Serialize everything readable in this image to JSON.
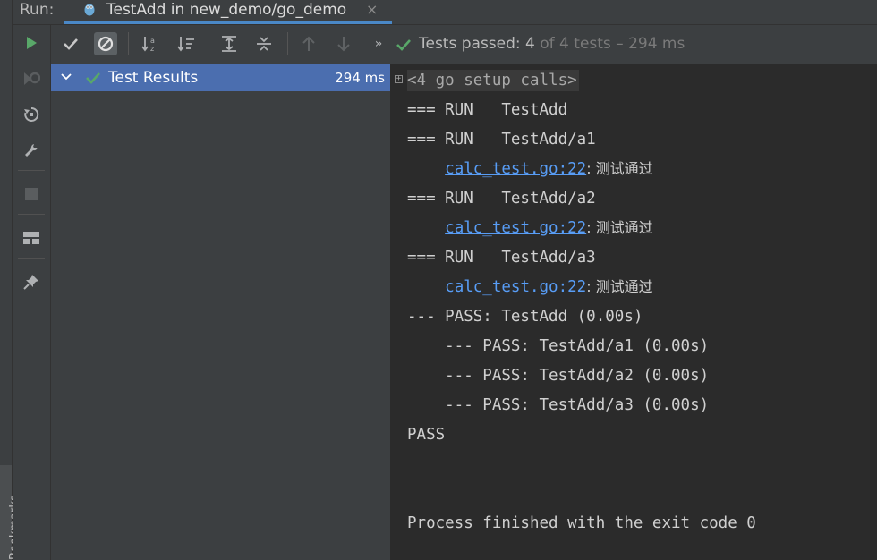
{
  "window": {
    "run_label": "Run:",
    "tab_title": "TestAdd in new_demo/go_demo",
    "close_glyph": "×"
  },
  "bookmarks_label": "Bookmarks",
  "toolbar": {
    "more_glyph": "»",
    "status_passed": "Tests passed: 4",
    "status_rest": " of 4 tests – 294 ms"
  },
  "tree": {
    "root_label": "Test Results",
    "root_time": "294 ms"
  },
  "console": {
    "fold_glyph": "+",
    "lines": [
      "<4 go setup calls>",
      "=== RUN   TestAdd",
      "=== RUN   TestAdd/a1",
      "    ",
      "=== RUN   TestAdd/a2",
      "    ",
      "=== RUN   TestAdd/a3",
      "    ",
      "--- PASS: TestAdd (0.00s)",
      "    --- PASS: TestAdd/a1 (0.00s)",
      "    --- PASS: TestAdd/a2 (0.00s)",
      "    --- PASS: TestAdd/a3 (0.00s)",
      "PASS",
      "",
      "",
      "Process finished with the exit code 0"
    ],
    "links": [
      {
        "text": "calc_test.go:22",
        "message": ": 测试通过"
      },
      {
        "text": "calc_test.go:22",
        "message": ": 测试通过"
      },
      {
        "text": "calc_test.go:22",
        "message": ": 测试通过"
      }
    ]
  },
  "colors": {
    "pass_green": "#59a869",
    "selection_blue": "#4b6eaf",
    "link_blue": "#589df6",
    "tab_underline": "#4a88c7"
  }
}
